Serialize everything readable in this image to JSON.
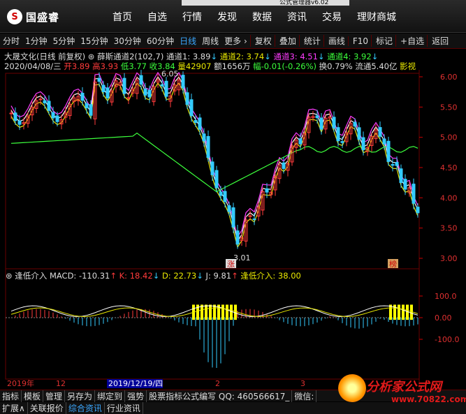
{
  "topbar": {
    "logo_mark": "S",
    "logo_text": "国盛睿",
    "title_strip": "公式管理器v6.02",
    "nav": [
      "首页",
      "自选",
      "行情",
      "发现",
      "数据",
      "资讯",
      "交易",
      "理财商城"
    ]
  },
  "toolbar": {
    "periods": [
      "分时",
      "1分钟",
      "5分钟",
      "15分钟",
      "30分钟",
      "60分钟",
      "日线",
      "周线",
      "更多 ›"
    ],
    "selected_period": "日线",
    "actions": [
      "复权",
      "叠加",
      "统计",
      "画线",
      "F10",
      "标记",
      "+自选",
      "返回"
    ]
  },
  "info": {
    "stock": "大晟文化(日线 前复权)",
    "indicator": "薛斯通道2(102,7)",
    "ch1": "通道1: 3.89",
    "ch2": "通道2: 3.74",
    "ch3": "通道3: 4.51",
    "ch4": "通道4: 3.92",
    "date": "2020/04/08/三",
    "open": "开3.89",
    "high": "高3.93",
    "low": "低3.77",
    "close": "收3.84",
    "volume": "量42907",
    "amount": "额1656万",
    "change": "幅-0.01(-0.26%)",
    "turnover": "换0.79%",
    "float": "流通5.40亿",
    "shadow": "影视"
  },
  "indicator_panel": {
    "name": "逢低介入",
    "macd": "MACD: -110.31",
    "k": "K: 18.42",
    "d": "D: 22.73",
    "j": "J: 9.81",
    "signal": "逢低介入: 38.00"
  },
  "price_axis": [
    "6.00",
    "5.50",
    "5.00",
    "4.50",
    "4.00",
    "3.50",
    "3.00"
  ],
  "ind_axis": [
    "100.0",
    "0.00",
    "-100.0"
  ],
  "annotations": {
    "high": "6.05",
    "low": "3.01",
    "tag1": "涨",
    "tag2": "榜"
  },
  "time_axis": {
    "start": "2019年",
    "m12": "12",
    "cursor": "2019/12/19/四",
    "m2": "2",
    "m3": "3"
  },
  "bottom_tabs1": [
    "指标",
    "模板",
    "管理",
    "另存为",
    "绑定到",
    "强势",
    "股票指标公式编写 QQ: 460566617_",
    "微信:"
  ],
  "bottom_tabs2": [
    "扩展∧",
    "关联报价",
    "综合资讯",
    "行业资讯"
  ],
  "watermark": {
    "text": "分析家公式网",
    "url": "www.70822.com"
  },
  "colors": {
    "up": "#ff3b3b",
    "down": "#3cf",
    "yellow": "#e8e800",
    "magenta": "#ff3cff",
    "green": "#3cff3c"
  }
}
